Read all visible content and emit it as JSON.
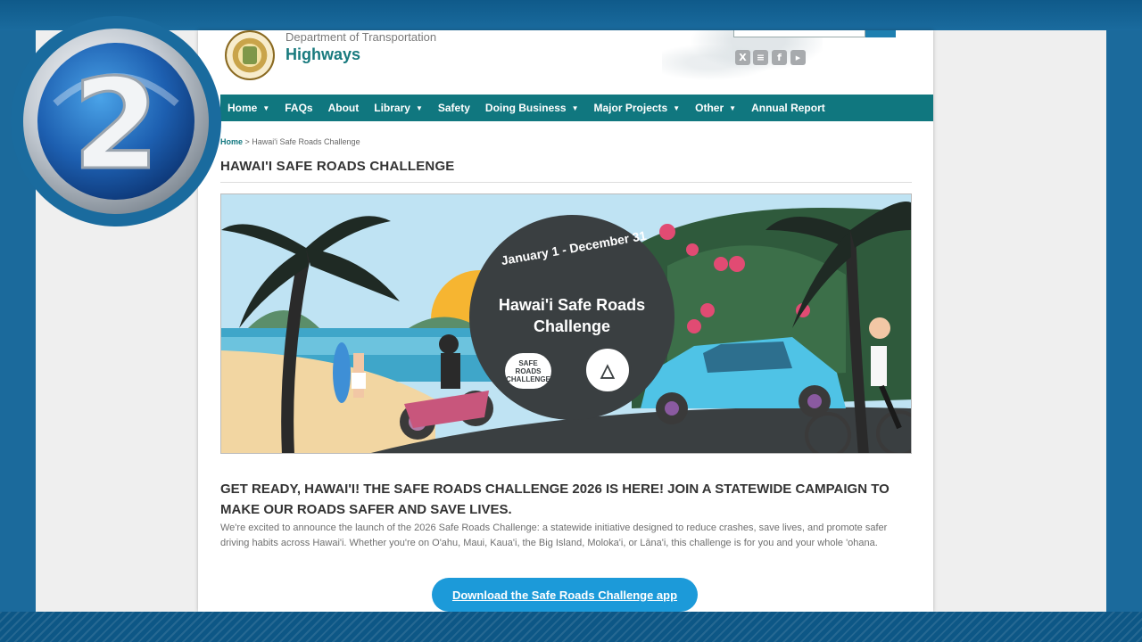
{
  "header": {
    "department": "Department of Transportation",
    "site_name": "Highways"
  },
  "social_icons": [
    "x-icon",
    "rss-icon",
    "facebook-icon",
    "youtube-icon"
  ],
  "nav": {
    "items": [
      {
        "label": "Home",
        "dropdown": true
      },
      {
        "label": "FAQs",
        "dropdown": false
      },
      {
        "label": "About",
        "dropdown": false
      },
      {
        "label": "Library",
        "dropdown": true
      },
      {
        "label": "Safety",
        "dropdown": false
      },
      {
        "label": "Doing Business",
        "dropdown": true
      },
      {
        "label": "Major Projects",
        "dropdown": true
      },
      {
        "label": "Other",
        "dropdown": true
      },
      {
        "label": "Annual Report",
        "dropdown": false
      }
    ]
  },
  "breadcrumb": {
    "home": "Home",
    "separator": " > ",
    "current": "Hawai'i Safe Roads Challenge"
  },
  "page_title": "HAWAI'I SAFE ROADS CHALLENGE",
  "banner": {
    "dates": "January 1 - December 31",
    "title_line1": "Hawai'i Safe Roads",
    "title_line2": "Challenge",
    "logo_text": "SAFE ROADS CHALLENGE"
  },
  "content": {
    "headline": "GET READY, HAWAI'I! THE SAFE ROADS CHALLENGE 2026 IS HERE! JOIN A STATEWIDE CAMPAIGN TO MAKE OUR ROADS SAFER AND SAVE LIVES.",
    "intro": "We're excited to announce the launch of the 2026 Safe Roads Challenge: a statewide initiative designed to reduce crashes, save lives, and promote safer driving habits across Hawai'i. Whether you're on O'ahu, Maui, Kaua'i, the Big Island, Moloka'i, or Lāna'i, this challenge is for you and your whole 'ohana.",
    "download_button": "Download the Safe Roads Challenge app"
  },
  "channel_logo": {
    "number": "2"
  },
  "colors": {
    "nav_bg": "#10777f",
    "brand_teal": "#187a7e",
    "button_blue": "#1c9ad9",
    "frame_blue": "#1b6a9c"
  }
}
